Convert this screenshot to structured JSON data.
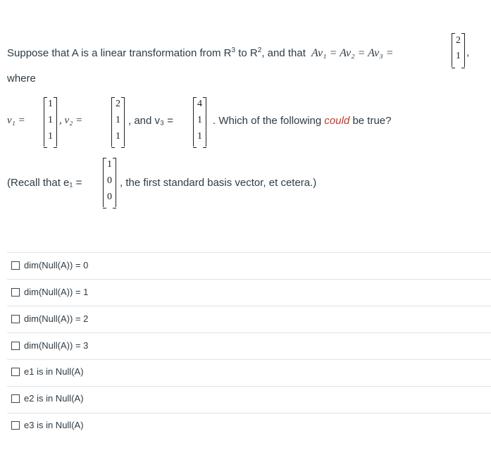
{
  "intro": {
    "text_before": "Suppose that A is a linear transformation from R",
    "sup1": "3",
    "text_mid": " to R",
    "sup2": "2",
    "text_after": ", and that",
    "equation": "Av₁ = Av₂ = Av₃ =",
    "result_vector": [
      "2",
      "1"
    ],
    "trailing": ","
  },
  "where_label": "where",
  "vectors": {
    "v1_label": "v₁ =",
    "v1": [
      "1",
      "1",
      "1"
    ],
    "v2_label": ", v₂ =",
    "v2": [
      "2",
      "1",
      "1"
    ],
    "v3_prefix": ", and v₃ =",
    "v3": [
      "4",
      "1",
      "1"
    ],
    "question_before": ". Which of the following ",
    "question_emph": "could",
    "question_after": " be true?"
  },
  "recall": {
    "prefix": "(Recall that e₁ =",
    "e1": [
      "1",
      "0",
      "0"
    ],
    "suffix": ", the first standard basis vector, et cetera.)"
  },
  "options": [
    "dim(Null(A)) = 0",
    "dim(Null(A)) = 1",
    "dim(Null(A)) = 2",
    "dim(Null(A)) = 3",
    "e1 is in Null(A)",
    "e2 is in Null(A)",
    "e3 is in Null(A)"
  ]
}
